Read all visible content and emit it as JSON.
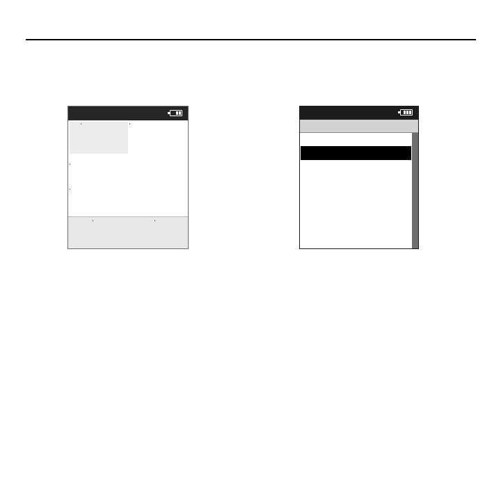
{
  "left_screen": {
    "battery": {
      "icon": "battery-icon",
      "level_cells": 2
    }
  },
  "right_screen": {
    "battery": {
      "icon": "battery-icon",
      "level_cells": 3
    },
    "menu": {
      "selected_index": 1
    }
  }
}
